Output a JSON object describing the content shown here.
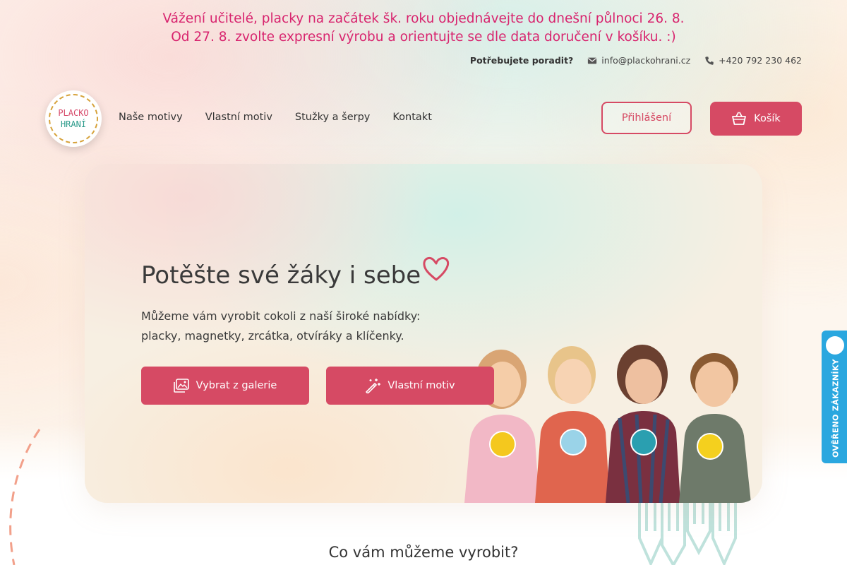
{
  "notice": {
    "line1": "Vážení učitelé, placky na začátek šk. roku objednávejte do dnešní půlnoci 26. 8.",
    "line2": "Od 27. 8. zvolte expresní výrobu a orientujte se dle data doručení v košíku. :)"
  },
  "contact": {
    "help_label": "Potřebujete poradit?",
    "email": "info@plackohrani.cz",
    "phone": "+420 792 230 462",
    "email_icon": "envelope-icon",
    "phone_icon": "phone-icon"
  },
  "logo": {
    "line1": "PLACKO",
    "line2": "HRANÍ"
  },
  "nav": {
    "items": [
      "Naše motivy",
      "Vlastní motiv",
      "Stužky a šerpy",
      "Kontakt"
    ]
  },
  "header": {
    "login_label": "Přihlášení",
    "cart_label": "Košík",
    "cart_icon": "basket-icon"
  },
  "hero": {
    "title": "Potěšte své žáky i sebe",
    "description_line1": "Můžeme vám vyrobit cokoli z naší široké nabídky:",
    "description_line2": "placky, magnetky, zrcátka, otvíráky a klíčenky.",
    "gallery_button": "Vybrat z galerie",
    "custom_button": "Vlastní motiv",
    "gallery_icon": "gallery-icon",
    "custom_icon": "magic-wand-icon"
  },
  "section": {
    "title": "Co vám můžeme vyrobit?"
  },
  "badge": {
    "label": "OVĚŘENO ZÁKAZNÍKY"
  },
  "colors": {
    "accent": "#d64a64",
    "notice": "#d8246e",
    "badge": "#2aa7df"
  }
}
